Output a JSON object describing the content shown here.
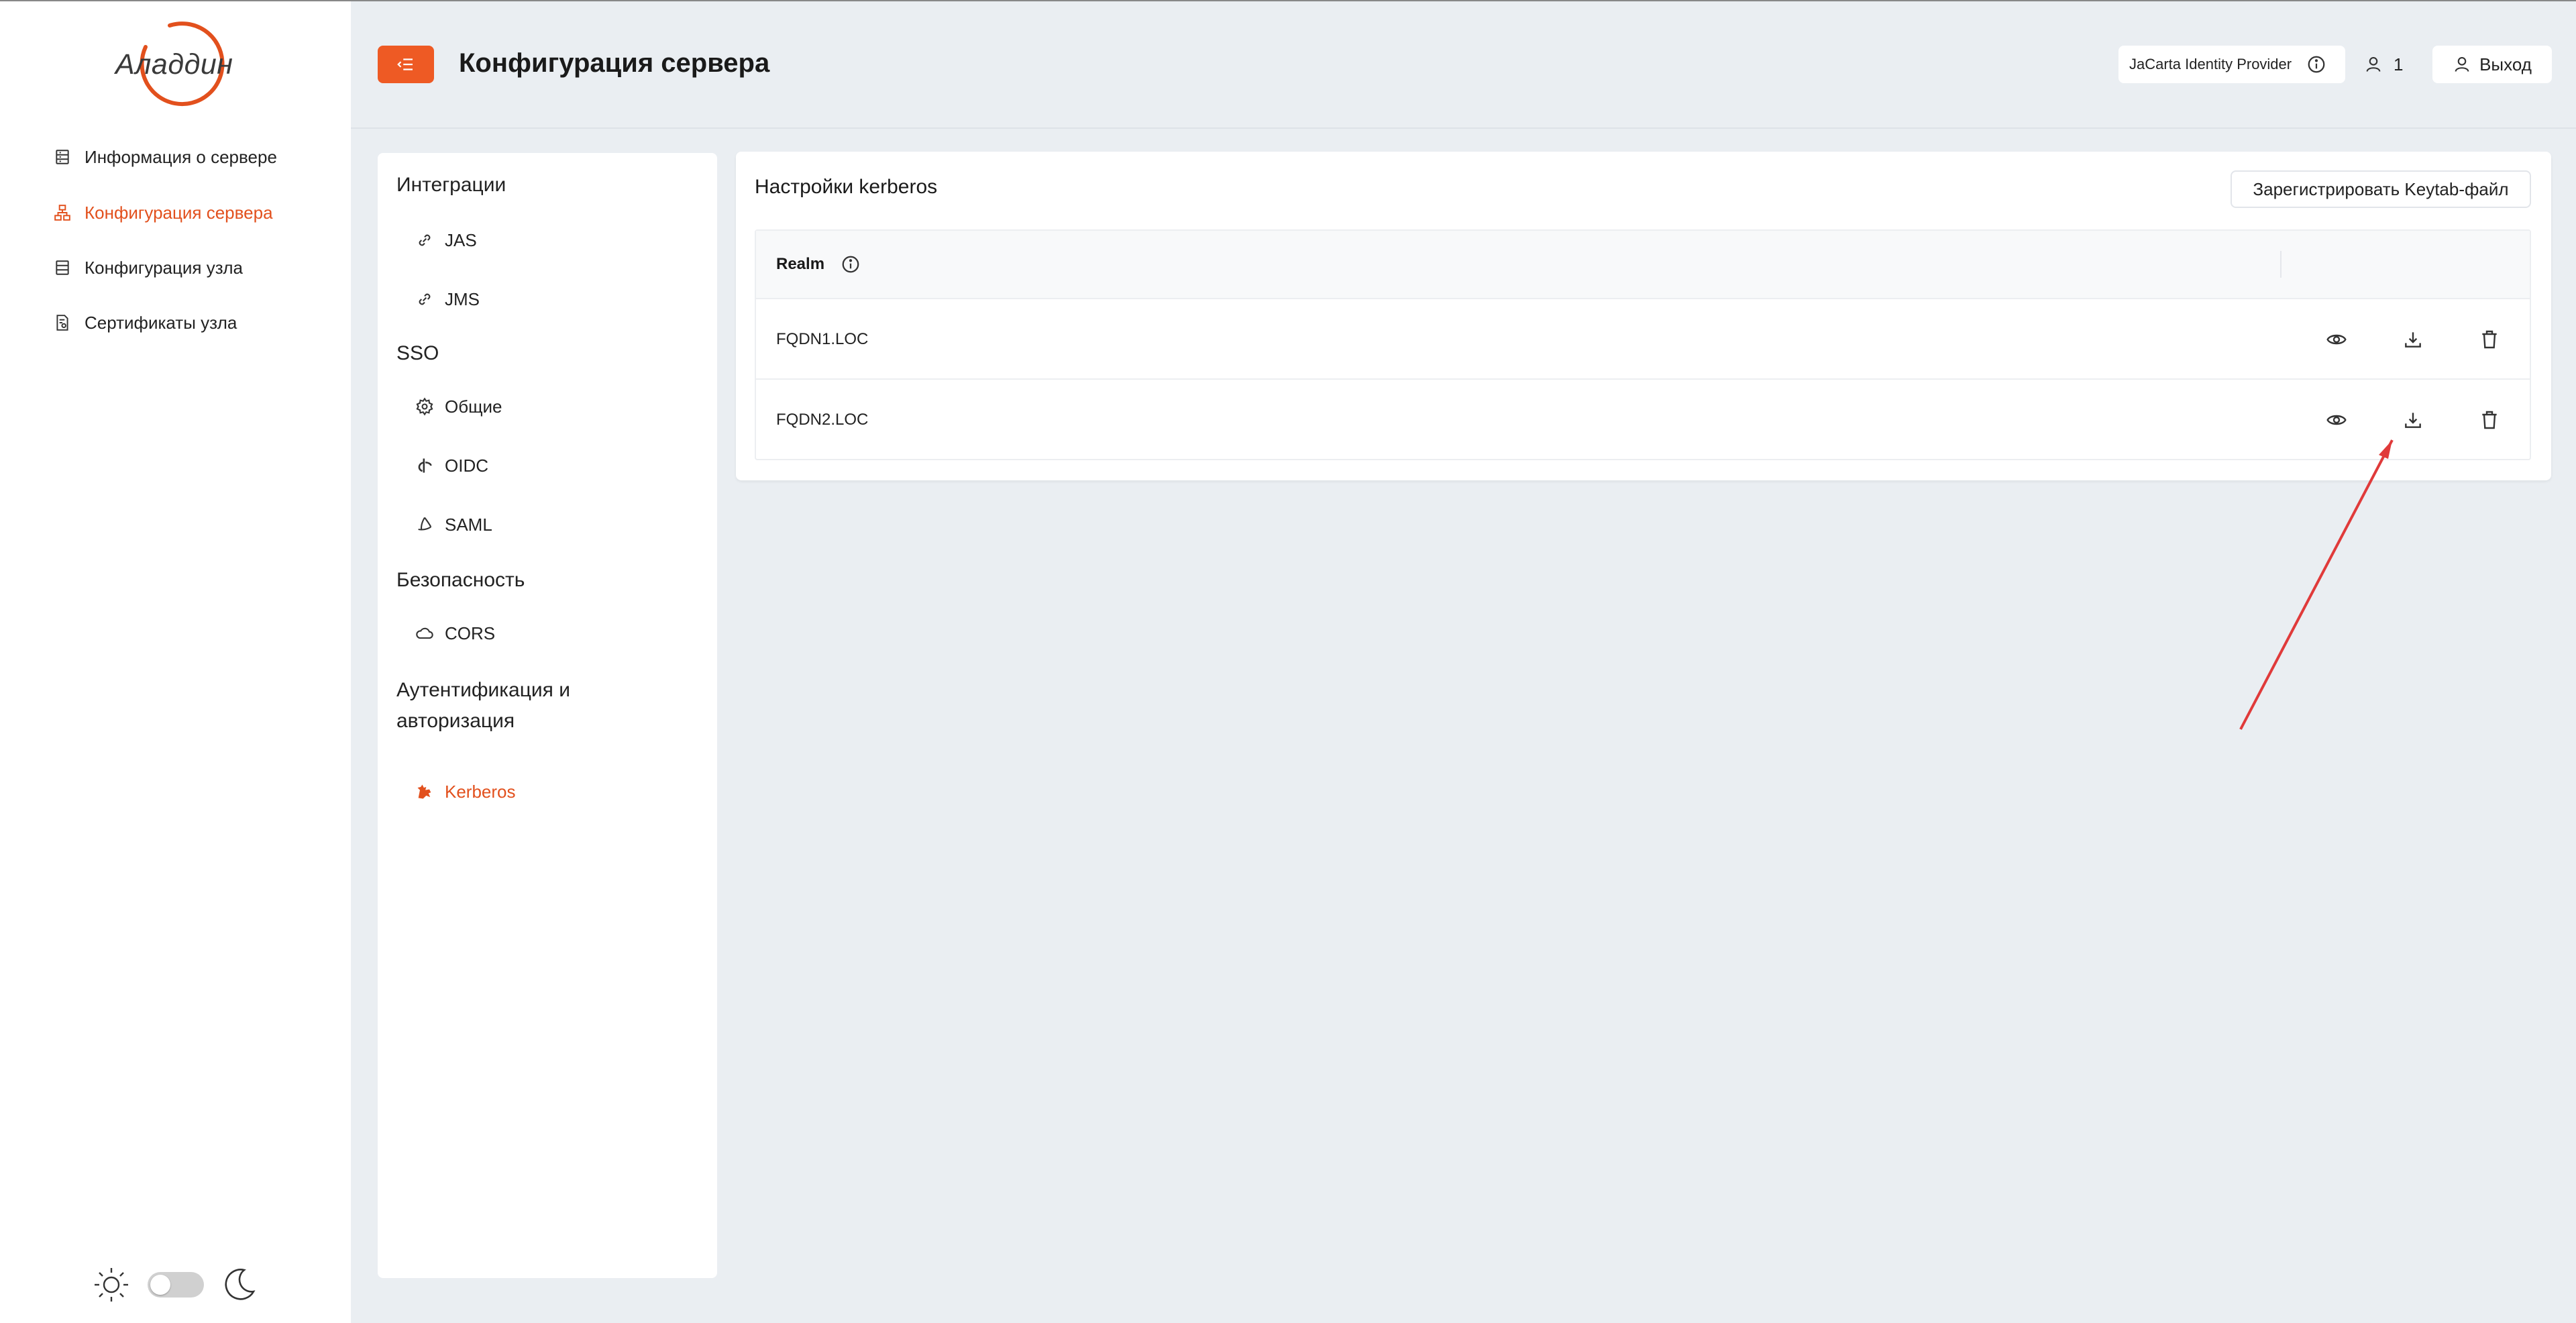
{
  "brand": {
    "logo_text": "Аладдин",
    "accent_color": "#e2501d"
  },
  "sidebar": {
    "items": [
      {
        "label": "Информация о сервере",
        "icon": "server-info-icon",
        "active": false
      },
      {
        "label": "Конфигурация сервера",
        "icon": "server-config-icon",
        "active": true
      },
      {
        "label": "Конфигурация узла",
        "icon": "node-config-icon",
        "active": false
      },
      {
        "label": "Сертификаты узла",
        "icon": "certificate-icon",
        "active": false
      }
    ],
    "theme": {
      "light_icon": "sun-icon",
      "dark_icon": "moon-icon",
      "dark_mode": false
    }
  },
  "header": {
    "title": "Конфигурация сервера",
    "idp_label": "JaCarta Identity Provider",
    "user_count": "1",
    "logout_label": "Выход"
  },
  "settings_nav": {
    "sections": [
      {
        "title": "Интеграции",
        "items": [
          {
            "label": "JAS",
            "icon": "link-icon"
          },
          {
            "label": "JMS",
            "icon": "link-icon"
          }
        ]
      },
      {
        "title": "SSO",
        "items": [
          {
            "label": "Общие",
            "icon": "gear-icon"
          },
          {
            "label": "OIDC",
            "icon": "openid-icon"
          },
          {
            "label": "SAML",
            "icon": "saml-icon"
          }
        ]
      },
      {
        "title": "Безопасность",
        "items": [
          {
            "label": "CORS",
            "icon": "cloud-icon"
          }
        ]
      },
      {
        "title": "Аутентификация и авторизация",
        "items": [
          {
            "label": "Kerberos",
            "icon": "kerberos-icon",
            "active": true
          }
        ]
      }
    ]
  },
  "kerberos": {
    "title": "Настройки kerberos",
    "register_label": "Зарегистрировать Keytab-файл",
    "column_realm": "Realm",
    "rows": [
      {
        "realm": "FQDN1.LOC"
      },
      {
        "realm": "FQDN2.LOC"
      }
    ],
    "row_actions": [
      "eye-icon",
      "download-icon",
      "trash-icon"
    ]
  }
}
